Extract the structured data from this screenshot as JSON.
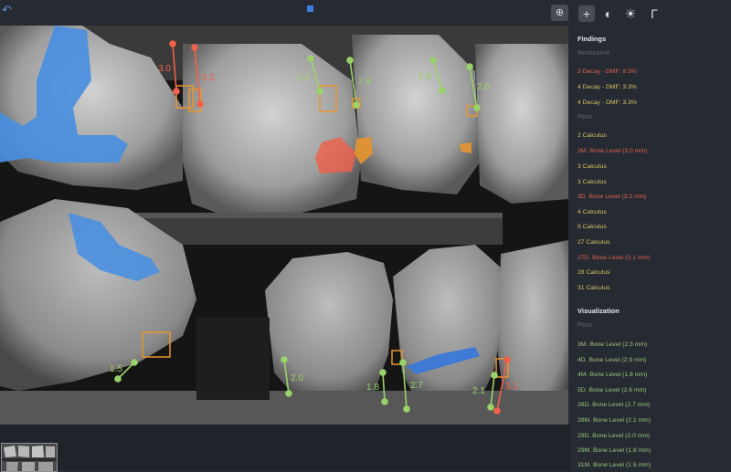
{
  "toolbar": {
    "zoom_icon": "zoom-icon",
    "back_icon": "back-arrow-icon"
  },
  "sidebar": {
    "tools": [
      "plus-icon",
      "contrast-icon",
      "brightness-icon",
      "angle-icon"
    ],
    "findings_title": "Findings",
    "restorative_title": "Restorative",
    "restorative": [
      {
        "label": "3 Decay - DMF: 6.5%",
        "color": "#e0604f"
      },
      {
        "label": "4 Decay - DMF: 3.3%",
        "color": "#d8c060"
      },
      {
        "label": "4 Decay - DMF: 3.3%",
        "color": "#d8c060"
      }
    ],
    "perio_title": "Perio",
    "perio": [
      {
        "label": "2 Calculus",
        "color": "#d8c060"
      },
      {
        "label": "2M. Bone Level (3.0 mm)",
        "color": "#e0604f"
      },
      {
        "label": "3 Calculus",
        "color": "#d8c060"
      },
      {
        "label": "3 Calculus",
        "color": "#d8c060"
      },
      {
        "label": "3D. Bone Level (3.2 mm)",
        "color": "#e0604f"
      },
      {
        "label": "4 Calculus",
        "color": "#d8c060"
      },
      {
        "label": "5 Calculus",
        "color": "#d8c060"
      },
      {
        "label": "27 Calculus",
        "color": "#d8c060"
      },
      {
        "label": "27D. Bone Level (3.1 mm)",
        "color": "#e0604f"
      },
      {
        "label": "28 Calculus",
        "color": "#d8c060"
      },
      {
        "label": "31 Calculus",
        "color": "#d8c060"
      }
    ],
    "visualization_title": "Visualization",
    "vis_perio_title": "Perio",
    "visualization": [
      {
        "label": "3M. Bone Level (2.3 mm)"
      },
      {
        "label": "4D. Bone Level (2.9 mm)"
      },
      {
        "label": "4M. Bone Level (1.8 mm)"
      },
      {
        "label": "5D. Bone Level (2.6 mm)"
      },
      {
        "label": "28D. Bone Level (2.7 mm)"
      },
      {
        "label": "28M. Bone Level (2.1 mm)"
      },
      {
        "label": "29D. Bone Level (2.0 mm)"
      },
      {
        "label": "29M. Bone Level (1.8 mm)"
      },
      {
        "label": "31M. Bone Level (1.5 mm)"
      }
    ]
  },
  "measurements": {
    "m30": "3.0",
    "m32": "3.2",
    "m23": "2.3",
    "m29": "2.9",
    "m18a": "1.8",
    "m26": "2.6",
    "m15": "1.5",
    "m20": "2.0",
    "m18b": "1.8",
    "m27": "2.7",
    "m21": "2.1",
    "m31": "3.1"
  },
  "colors": {
    "red": "#f0604a",
    "green": "#9ad26a",
    "orange": "#e8962e",
    "blue": "#4a8fe0"
  }
}
